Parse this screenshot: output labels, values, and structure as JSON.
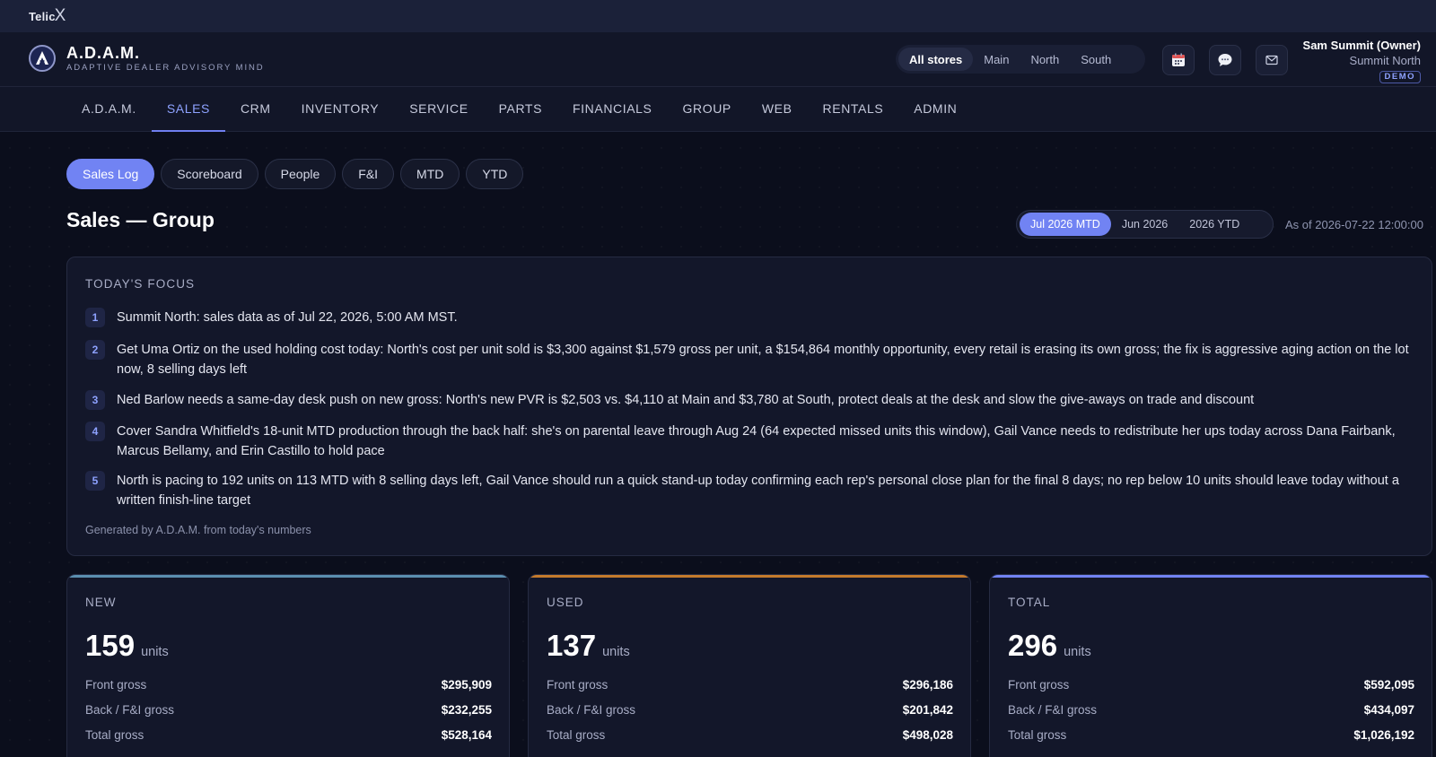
{
  "topbar": {
    "brand": "Telic",
    "brand_x": "X"
  },
  "header": {
    "app_title": "A.D.A.M.",
    "app_subtitle": "ADAPTIVE DEALER ADVISORY MIND",
    "store_filter": [
      {
        "label": "All stores",
        "active": true
      },
      {
        "label": "Main",
        "active": false
      },
      {
        "label": "North",
        "active": false
      },
      {
        "label": "South",
        "active": false
      }
    ],
    "icons": {
      "calendar": "calendar-icon",
      "chat": "chat-icon",
      "mail": "mail-icon"
    },
    "user": {
      "name": "Sam Summit (Owner)",
      "store": "Summit North",
      "badge": "DEMO"
    }
  },
  "nav": {
    "items": [
      {
        "label": "A.D.A.M.",
        "active": false
      },
      {
        "label": "SALES",
        "active": true
      },
      {
        "label": "CRM",
        "active": false
      },
      {
        "label": "INVENTORY",
        "active": false
      },
      {
        "label": "SERVICE",
        "active": false
      },
      {
        "label": "PARTS",
        "active": false
      },
      {
        "label": "FINANCIALS",
        "active": false
      },
      {
        "label": "GROUP",
        "active": false
      },
      {
        "label": "WEB",
        "active": false
      },
      {
        "label": "RENTALS",
        "active": false
      },
      {
        "label": "ADMIN",
        "active": false
      }
    ]
  },
  "subtabs": [
    {
      "label": "Sales Log",
      "active": true
    },
    {
      "label": "Scoreboard",
      "active": false
    },
    {
      "label": "People",
      "active": false
    },
    {
      "label": "F&I",
      "active": false
    },
    {
      "label": "MTD",
      "active": false
    },
    {
      "label": "YTD",
      "active": false
    }
  ],
  "page": {
    "title": "Sales — Group",
    "periods": [
      {
        "label": "Jul 2026 MTD",
        "active": true
      },
      {
        "label": "Jun 2026",
        "active": false
      },
      {
        "label": "2026 YTD",
        "active": false
      }
    ],
    "as_of": "As of 2026-07-22 12:00:00"
  },
  "focus": {
    "heading": "TODAY'S FOCUS",
    "items": [
      {
        "num": "1",
        "text": "Summit North: sales data as of Jul 22, 2026, 5:00 AM MST."
      },
      {
        "num": "2",
        "text": "Get Uma Ortiz on the used holding cost today: North's cost per unit sold is $3,300 against $1,579 gross per unit, a $154,864 monthly opportunity, every retail is erasing its own gross; the fix is aggressive aging action on the lot now, 8 selling days left"
      },
      {
        "num": "3",
        "text": "Ned Barlow needs a same-day desk push on new gross: North's new PVR is $2,503 vs. $4,110 at Main and $3,780 at South, protect deals at the desk and slow the give-aways on trade and discount"
      },
      {
        "num": "4",
        "text": "Cover Sandra Whitfield's 18-unit MTD production through the back half: she's on parental leave through Aug 24 (64 expected missed units this window), Gail Vance needs to redistribute her ups today across Dana Fairbank, Marcus Bellamy, and Erin Castillo to hold pace"
      },
      {
        "num": "5",
        "text": "North is pacing to 192 units on 113 MTD with 8 selling days left, Gail Vance should run a quick stand-up today confirming each rep's personal close plan for the final 8 days; no rep below 10 units should leave today without a written finish-line target"
      }
    ],
    "footer": "Generated by A.D.A.M. from today's numbers"
  },
  "kpis": [
    {
      "label": "NEW",
      "value": "159",
      "unit": "units",
      "accent": "#5b8fb0",
      "rows": [
        {
          "label": "Front gross",
          "value": "$295,909"
        },
        {
          "label": "Back / F&I gross",
          "value": "$232,255"
        },
        {
          "label": "Total gross",
          "value": "$528,164"
        }
      ]
    },
    {
      "label": "USED",
      "value": "137",
      "unit": "units",
      "accent": "#c47a2c",
      "rows": [
        {
          "label": "Front gross",
          "value": "$296,186"
        },
        {
          "label": "Back / F&I gross",
          "value": "$201,842"
        },
        {
          "label": "Total gross",
          "value": "$498,028"
        }
      ]
    },
    {
      "label": "TOTAL",
      "value": "296",
      "unit": "units",
      "accent": "#7183f3",
      "rows": [
        {
          "label": "Front gross",
          "value": "$592,095"
        },
        {
          "label": "Back / F&I gross",
          "value": "$434,097"
        },
        {
          "label": "Total gross",
          "value": "$1,026,192"
        }
      ]
    }
  ]
}
